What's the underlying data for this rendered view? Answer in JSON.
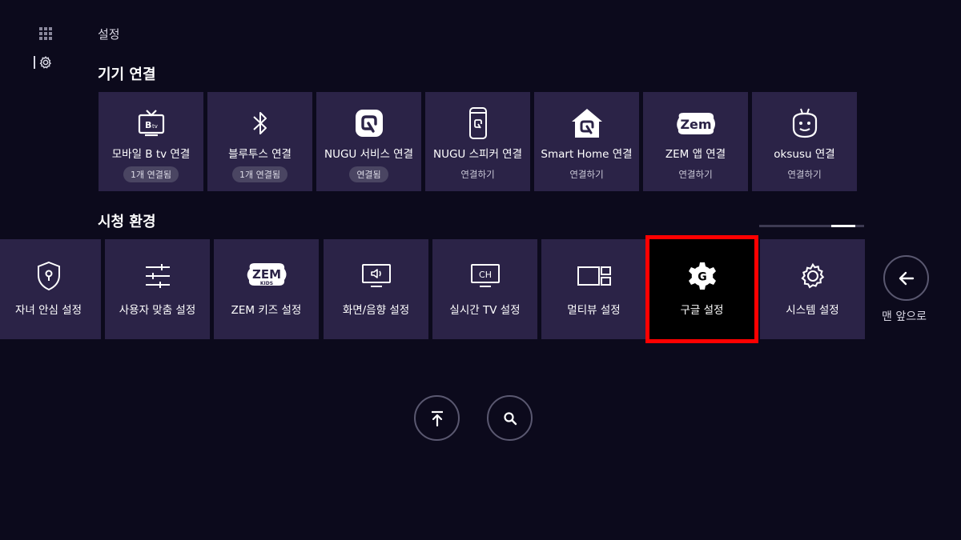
{
  "page": {
    "title": "설정"
  },
  "sidebar": {
    "items": [
      {
        "icon": "apps-grid-icon"
      },
      {
        "icon": "gear-icon",
        "active": true
      }
    ]
  },
  "device_section": {
    "title": "기기 연결",
    "tiles": [
      {
        "icon": "btv-tv-icon",
        "label": "모바일 B tv 연결",
        "status": "1개 연결됨",
        "status_style": "badge"
      },
      {
        "icon": "bluetooth-icon",
        "label": "블루투스 연결",
        "status": "1개 연결됨",
        "status_style": "badge"
      },
      {
        "icon": "nugu-icon",
        "label": "NUGU 서비스 연결",
        "status": "연결됨",
        "status_style": "badge"
      },
      {
        "icon": "nugu-speaker-icon",
        "label": "NUGU 스피커 연결",
        "status": "연결하기",
        "status_style": "text"
      },
      {
        "icon": "smart-home-icon",
        "label": "Smart Home 연결",
        "status": "연결하기",
        "status_style": "text"
      },
      {
        "icon": "zem-icon",
        "label": "ZEM 앱 연결",
        "status": "연결하기",
        "status_style": "text"
      },
      {
        "icon": "oksusu-icon",
        "label": "oksusu 연결",
        "status": "연결하기",
        "status_style": "text"
      }
    ]
  },
  "viewing_section": {
    "title": "시청 환경",
    "tiles": [
      {
        "icon": "shield-lock-icon",
        "label": "자녀 안심 설정"
      },
      {
        "icon": "sliders-icon",
        "label": "사용자 맞춤 설정"
      },
      {
        "icon": "zem-kids-icon",
        "label": "ZEM 키즈 설정",
        "logo_text": "ZEM",
        "logo_sub": "KIDS"
      },
      {
        "icon": "screen-sound-icon",
        "label": "화면/음향 설정"
      },
      {
        "icon": "channel-icon",
        "label": "실시간 TV 설정",
        "icon_text": "CH"
      },
      {
        "icon": "multiview-icon",
        "label": "멀티뷰 설정"
      },
      {
        "icon": "google-gear-icon",
        "label": "구글 설정",
        "focused": true
      },
      {
        "icon": "gear-icon",
        "label": "시스템 설정"
      }
    ],
    "scroll_position": 0.85
  },
  "nav": {
    "front_label": "맨 앞으로",
    "front_icon": "arrow-left-icon",
    "top_icon": "arrow-to-top-icon",
    "search_icon": "search-icon"
  },
  "colors": {
    "background": "#0c0a1c",
    "tile": "#2b2347",
    "focus_outline": "#ff0000",
    "badge": "#4a4562"
  }
}
